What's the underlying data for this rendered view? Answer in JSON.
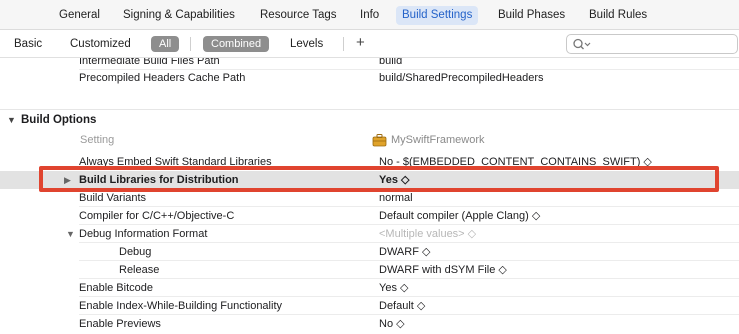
{
  "tabs": [
    {
      "label": "General"
    },
    {
      "label": "Signing & Capabilities"
    },
    {
      "label": "Resource Tags"
    },
    {
      "label": "Info"
    },
    {
      "label": "Build Settings",
      "active": true
    },
    {
      "label": "Build Phases"
    },
    {
      "label": "Build Rules"
    }
  ],
  "filter": {
    "basic": "Basic",
    "customized": "Customized",
    "all": "All",
    "combined": "Combined",
    "levels": "Levels",
    "add": "+",
    "search_icon": "magnifier-with-chevron-icon",
    "search_value": ""
  },
  "top_rows": [
    {
      "name": "Intermediate Build Files Path",
      "value": "build"
    },
    {
      "name": "Precompiled Headers Cache Path",
      "value": "build/SharedPrecompiledHeaders"
    }
  ],
  "section": {
    "title": "Build Options",
    "col_setting": "Setting",
    "col_target": "MySwiftFramework",
    "target_icon": "toolbox-icon"
  },
  "rows": [
    {
      "name": "Always Embed Swift Standard Libraries",
      "value": "No  -  $(EMBEDDED_CONTENT_CONTAINS_SWIFT) ◇"
    },
    {
      "name": "Build Libraries for Distribution",
      "value": "Yes ◇",
      "selected": true
    },
    {
      "name": "Build Variants",
      "value": "normal"
    },
    {
      "name": "Compiler for C/C++/Objective-C",
      "value": "Default compiler (Apple Clang) ◇"
    },
    {
      "name": "Debug Information Format",
      "value": "<Multiple values> ◇"
    },
    {
      "name": "Debug",
      "value": "DWARF ◇"
    },
    {
      "name": "Release",
      "value": "DWARF with dSYM File ◇"
    },
    {
      "name": "Enable Bitcode",
      "value": "Yes ◇"
    },
    {
      "name": "Enable Index-While-Building Functionality",
      "value": "Default ◇"
    },
    {
      "name": "Enable Previews",
      "value": "No ◇"
    }
  ],
  "colors": {
    "accent": "#2563c9",
    "highlight": "#e0442f",
    "selected_row": "#e2e2e2"
  }
}
